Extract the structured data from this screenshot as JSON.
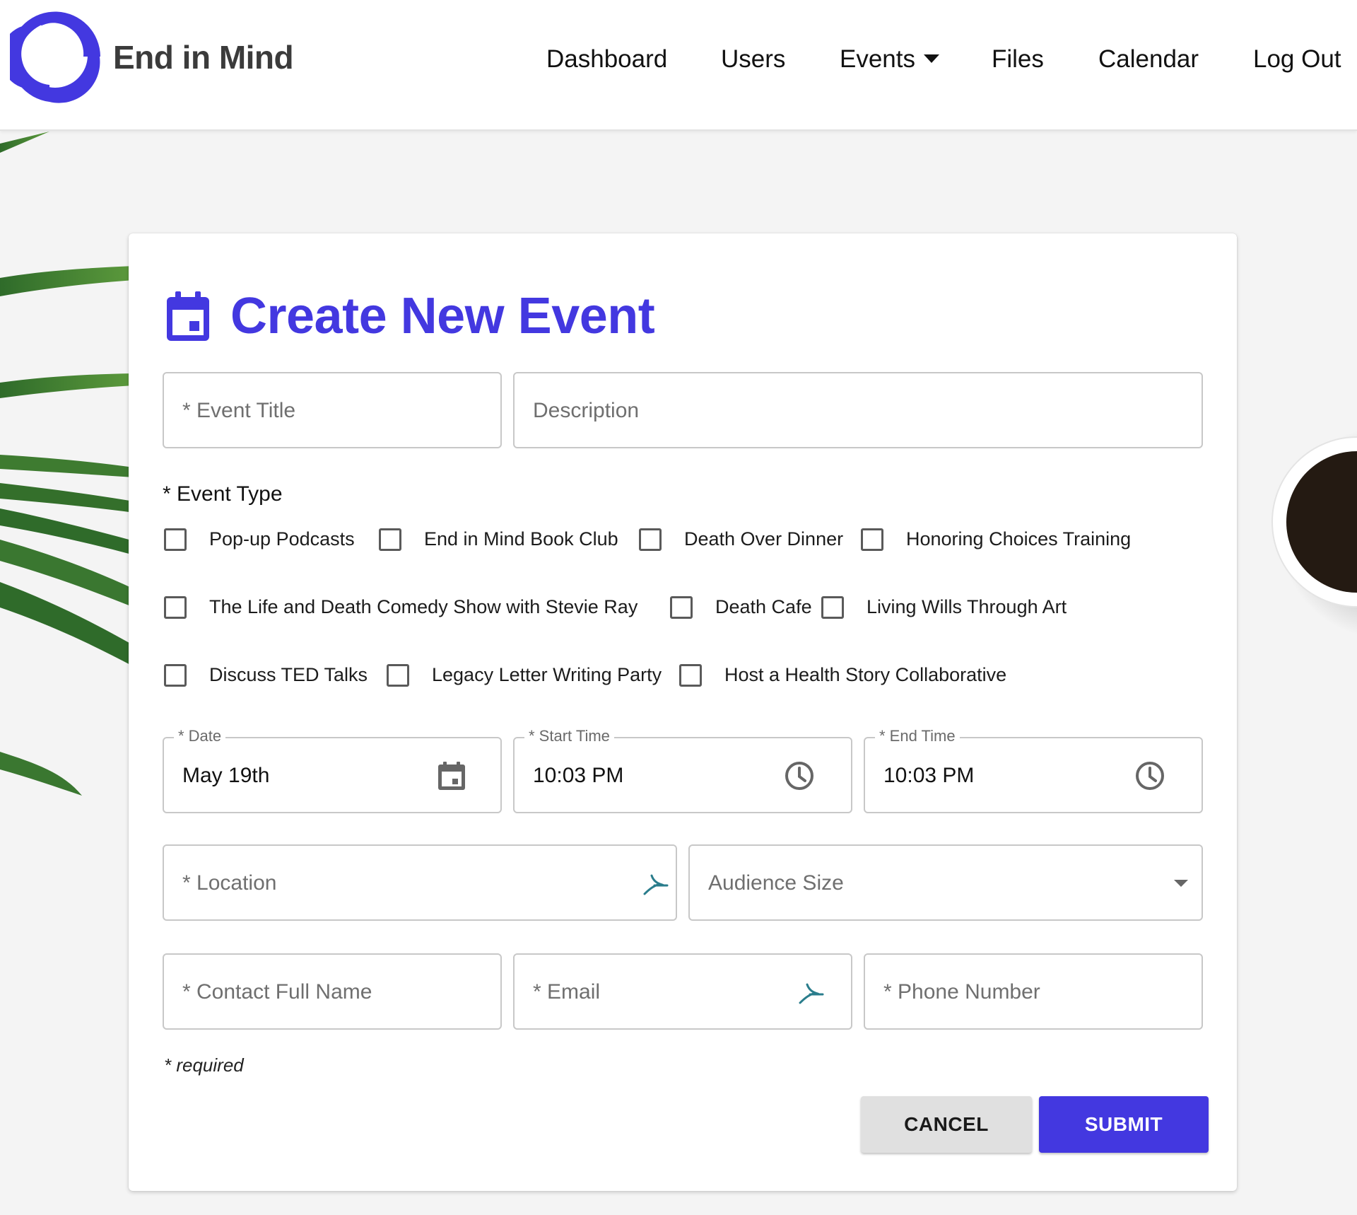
{
  "brand": {
    "name": "End in Mind",
    "accent_color": "#4338e0"
  },
  "nav": {
    "items": [
      "Dashboard",
      "Users",
      "Events",
      "Files",
      "Calendar",
      "Log Out"
    ]
  },
  "form": {
    "title": "Create New Event",
    "title_icon": "calendar-icon",
    "event_title_placeholder": "* Event Title",
    "description_placeholder": "Description",
    "event_type_label": "* Event Type",
    "event_types": [
      "Pop-up Podcasts",
      "End in Mind Book Club",
      "Death Over Dinner",
      "Honoring Choices Training",
      "The Life and Death Comedy Show with Stevie Ray",
      "Death Cafe",
      "Living Wills Through Art",
      "Discuss TED Talks",
      "Legacy Letter Writing Party",
      "Host a Health Story Collaborative"
    ],
    "date": {
      "label": "* Date",
      "value": "May 19th",
      "icon": "calendar-icon"
    },
    "start_time": {
      "label": "* Start Time",
      "value": "10:03 PM",
      "icon": "clock-icon"
    },
    "end_time": {
      "label": "* End Time",
      "value": "10:03 PM",
      "icon": "clock-icon"
    },
    "location_placeholder": "* Location",
    "audience_size_placeholder": "Audience Size",
    "contact_name_placeholder": "* Contact Full Name",
    "email_placeholder": "* Email",
    "phone_placeholder": "* Phone Number",
    "required_note": "* required",
    "cancel_label": "CANCEL",
    "submit_label": "SUBMIT"
  }
}
